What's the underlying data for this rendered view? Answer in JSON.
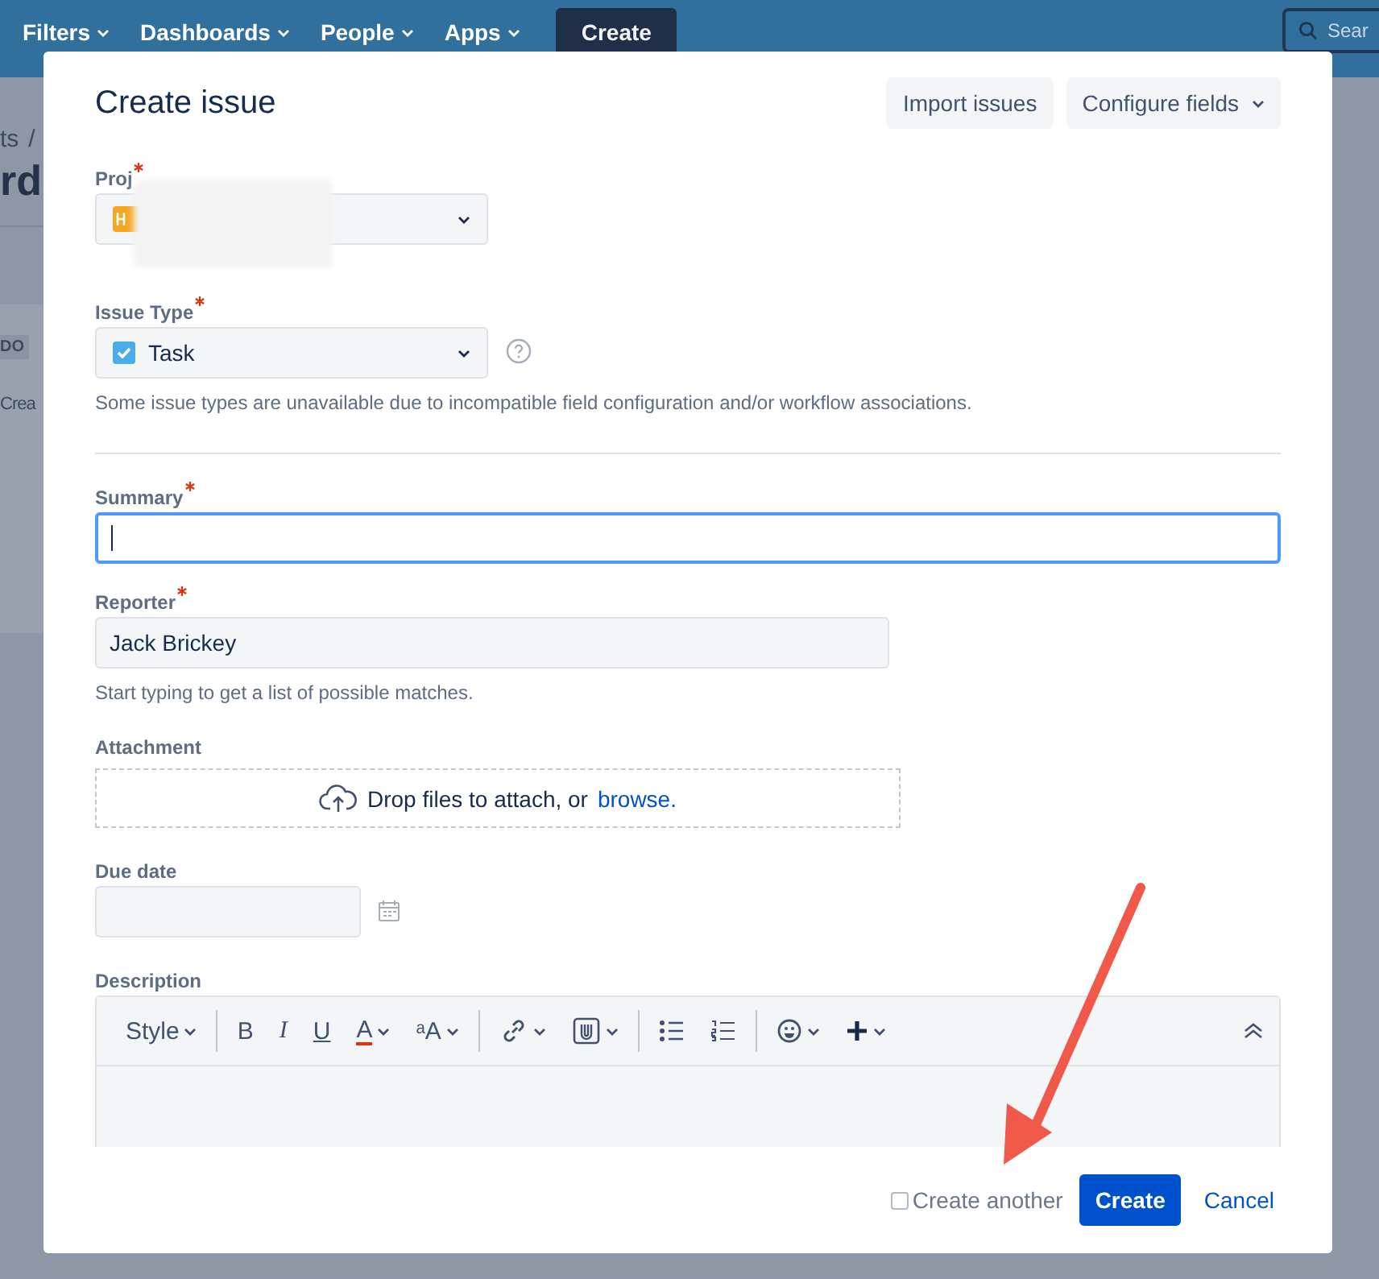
{
  "nav": {
    "items": [
      {
        "label": "Filters"
      },
      {
        "label": "Dashboards"
      },
      {
        "label": "People"
      },
      {
        "label": "Apps"
      }
    ],
    "create_button": "Create",
    "search_placeholder": "Sear"
  },
  "background": {
    "breadcrumb": "ts",
    "separator": "/",
    "heading": "rd",
    "column_badge": "DO",
    "create_link": "Crea"
  },
  "dialog": {
    "title": "Create issue",
    "header_buttons": [
      {
        "label": "Import issues",
        "kind": "plain"
      },
      {
        "label": "Configure fields",
        "kind": "dropdown"
      }
    ],
    "project": {
      "label": "Proj",
      "required": true
    },
    "issue_type": {
      "label": "Issue Type",
      "required": true,
      "value": "Task",
      "help_text": "Some issue types are unavailable due to incompatible field configuration and/or workflow associations."
    },
    "summary": {
      "label": "Summary",
      "required": true,
      "focused": true
    },
    "reporter": {
      "label": "Reporter",
      "required": true,
      "value": "Jack Brickey",
      "hint": "Start typing to get a list of possible matches."
    },
    "attachment": {
      "label": "Attachment",
      "required": false,
      "text": "Drop files to attach, or",
      "link": "browse."
    },
    "due_date": {
      "label": "Due date",
      "required": false
    },
    "description": {
      "label": "Description",
      "required": false,
      "toolbar": [
        {
          "kind": "style",
          "label": "Style",
          "caret": true
        },
        {
          "kind": "separator"
        },
        {
          "kind": "bold",
          "label": "B",
          "caret": false
        },
        {
          "kind": "italic",
          "label": "I",
          "caret": false
        },
        {
          "kind": "underline",
          "label": "U",
          "caret": false
        },
        {
          "kind": "color",
          "label": "A",
          "caret": true
        },
        {
          "kind": "size",
          "label": "ᵃA",
          "caret": true
        },
        {
          "kind": "separator"
        },
        {
          "kind": "link",
          "caret": true
        },
        {
          "kind": "attach",
          "caret": true
        },
        {
          "kind": "separator"
        },
        {
          "kind": "bullets",
          "caret": false
        },
        {
          "kind": "numbers",
          "caret": false
        },
        {
          "kind": "separator"
        },
        {
          "kind": "emoji",
          "caret": true
        },
        {
          "kind": "insert",
          "caret": true
        }
      ]
    },
    "footer": {
      "create_another": {
        "label": "Create another",
        "checked": false
      },
      "submit": "Create",
      "cancel": "Cancel"
    }
  }
}
